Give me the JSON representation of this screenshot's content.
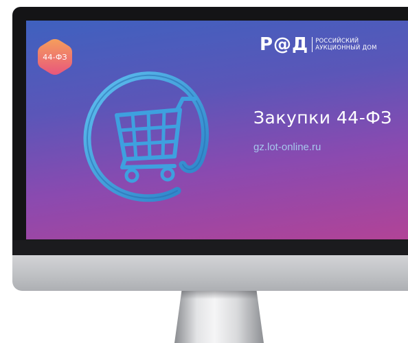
{
  "badge": {
    "label": "44-ФЗ",
    "colors": [
      "#f39a5a",
      "#ea5a7a"
    ]
  },
  "logo": {
    "mark": "Р@Д",
    "line1": "РОССИЙСКИЙ",
    "line2": "АУКЦИОННЫЙ ДОМ"
  },
  "headline": "Закупки 44-ФЗ",
  "url": "gz.lot-online.ru",
  "emblem": {
    "icon": "shopping-cart-icon",
    "color": "#3ea0df"
  },
  "colors": {
    "screen_top": "#3f61bf",
    "screen_bottom": "#b24396",
    "bezel": "#141416",
    "chin": "#c4c5c8",
    "url_text": "#a6c6ec"
  }
}
